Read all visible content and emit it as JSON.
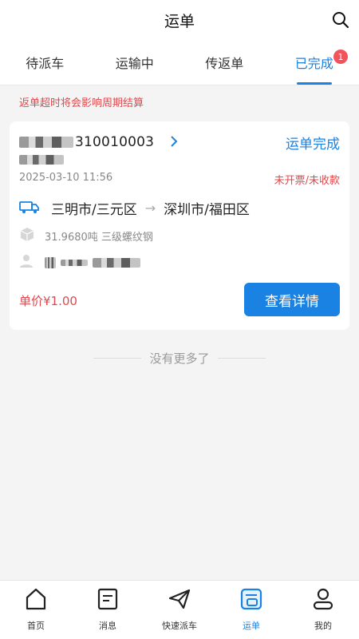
{
  "header": {
    "title": "运单"
  },
  "tabs": [
    {
      "label": "待派车"
    },
    {
      "label": "运输中"
    },
    {
      "label": "传返单"
    },
    {
      "label": "已完成",
      "badge": "1"
    }
  ],
  "notice": "返单超时将会影响周期结算",
  "order": {
    "order_no_visible": "310010003",
    "status": "运单完成",
    "date": "2025-03-10 11:56",
    "pay_status": "未开票/未收款",
    "from": "三明市/三元区",
    "to": "深圳市/福田区",
    "goods": "31.9680吨 三级螺纹钢",
    "price": "单价¥1.00",
    "detail_button": "查看详情"
  },
  "list_end": "没有更多了",
  "tabbar": [
    {
      "label": "首页",
      "icon": "home-icon"
    },
    {
      "label": "消息",
      "icon": "message-icon"
    },
    {
      "label": "快速派车",
      "icon": "send-icon"
    },
    {
      "label": "运单",
      "icon": "waybill-icon"
    },
    {
      "label": "我的",
      "icon": "profile-icon"
    }
  ],
  "colors": {
    "accent": "#1a82e2",
    "alert": "#e0494e",
    "background": "#f4f4f4"
  }
}
